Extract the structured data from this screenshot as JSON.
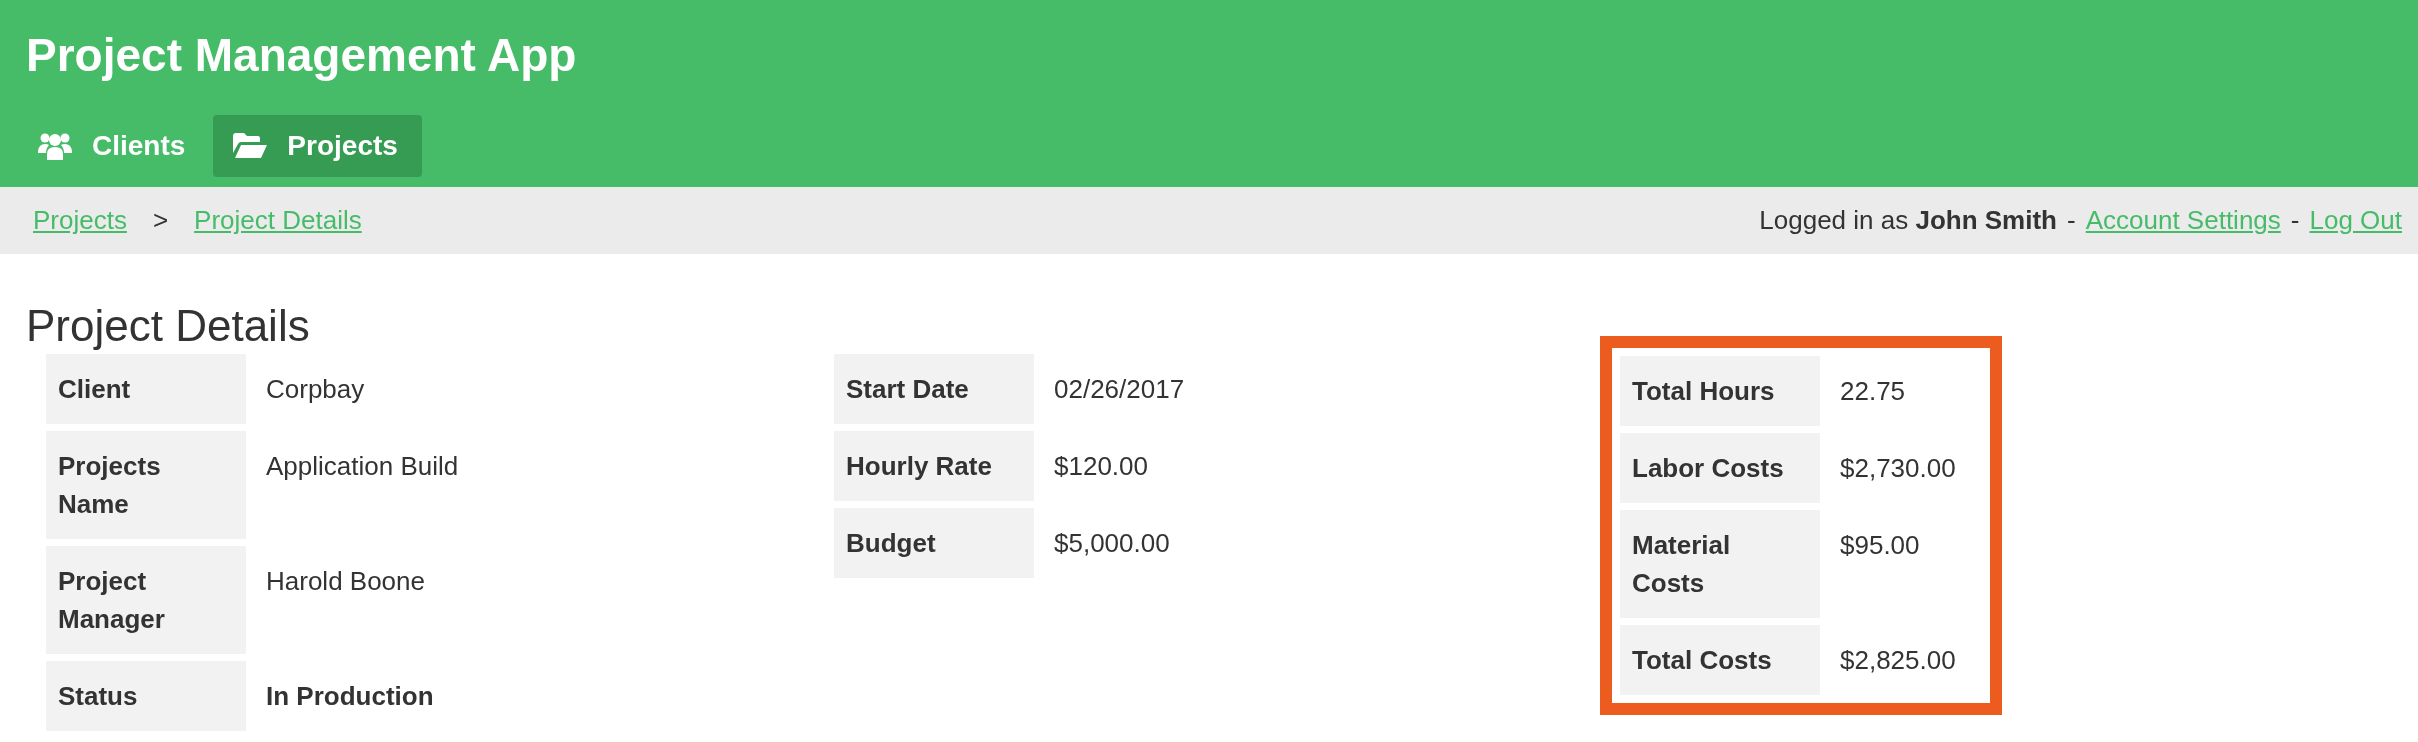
{
  "app": {
    "title": "Project Management App"
  },
  "nav": [
    {
      "label": "Clients",
      "selected": false
    },
    {
      "label": "Projects",
      "selected": true
    }
  ],
  "breadcrumbs": {
    "items": [
      "Projects",
      "Project Details"
    ],
    "separator": ">"
  },
  "account": {
    "text": "Logged in as **John Smith**",
    "separator": "-",
    "links": [
      "Account Settings",
      "Log Out"
    ]
  },
  "page": {
    "title": "Project Details"
  },
  "tables": [
    {
      "highlighted": false,
      "rows": [
        {
          "label": "Client",
          "value": "Corpbay",
          "bold": false
        },
        {
          "label": "Projects Name",
          "value": "Application Build",
          "bold": false
        },
        {
          "label": "Project Manager",
          "value": "Harold Boone",
          "bold": false
        },
        {
          "label": "Status",
          "value": "In Production",
          "bold": true
        }
      ]
    },
    {
      "highlighted": false,
      "rows": [
        {
          "label": "Start Date",
          "value": "02/26/2017",
          "bold": false
        },
        {
          "label": "Hourly Rate",
          "value": "$120.00",
          "bold": false
        },
        {
          "label": "Budget",
          "value": "$5,000.00",
          "bold": false
        }
      ]
    },
    {
      "highlighted": true,
      "rows": [
        {
          "label": "Total Hours",
          "value": "22.75",
          "bold": false
        },
        {
          "label": "Labor Costs",
          "value": "$2,730.00",
          "bold": false
        },
        {
          "label": "Material Costs",
          "value": "$95.00",
          "bold": false
        },
        {
          "label": "Total Costs",
          "value": "$2,825.00",
          "bold": false
        }
      ]
    }
  ]
}
